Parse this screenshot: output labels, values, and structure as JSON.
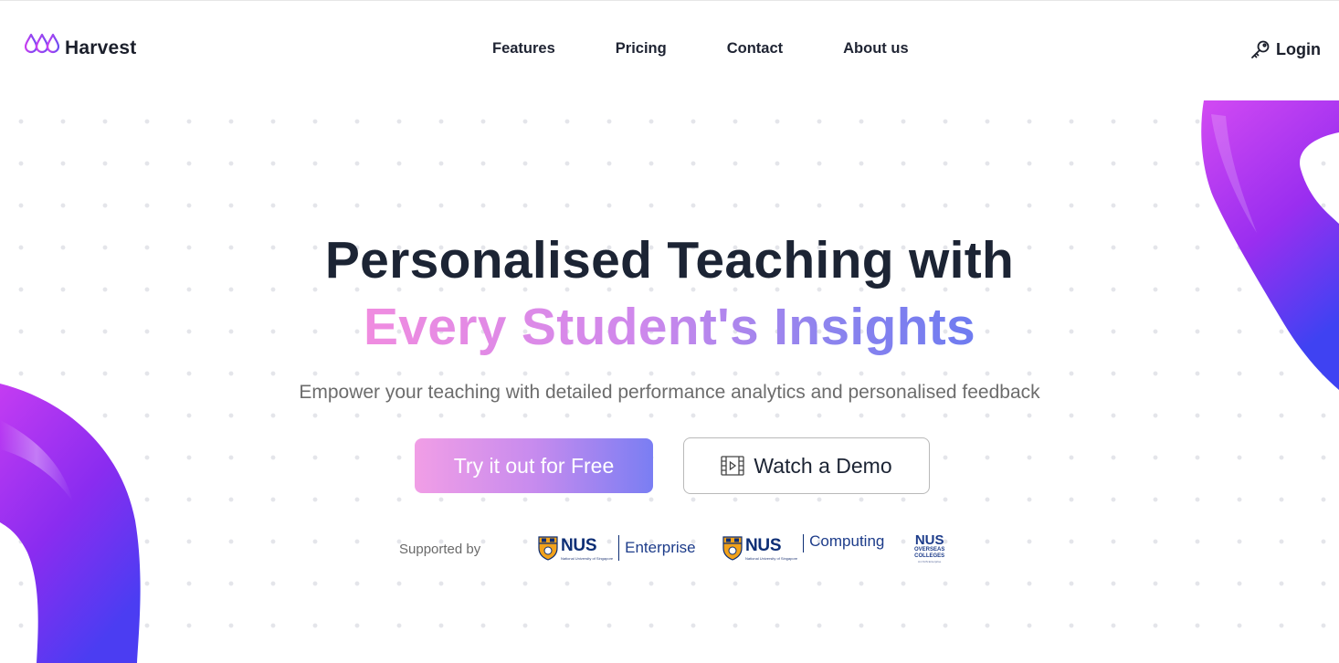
{
  "brand": {
    "name": "Harvest",
    "accent": "#a23cf0"
  },
  "nav": {
    "links": [
      "Features",
      "Pricing",
      "Contact",
      "About us"
    ],
    "login_label": "Login"
  },
  "hero": {
    "title_line1": "Personalised Teaching with",
    "title_line2": "Every Student's Insights",
    "subtitle": "Empower your teaching with detailed performance analytics and personalised feedback",
    "primary_cta": "Try it out for Free",
    "secondary_cta": "Watch a Demo"
  },
  "supporters": {
    "label": "Supported by",
    "items": [
      {
        "org": "NUS",
        "org_sub": "National University of Singapore",
        "unit": "Enterprise"
      },
      {
        "org": "NUS",
        "org_sub": "National University of Singapore",
        "unit": "Computing"
      },
      {
        "org": "NUS",
        "line2": "OVERSEAS",
        "line3": "COLLEGES",
        "tagline": "An NUS Enterprise"
      }
    ]
  },
  "icons": {
    "logo": "harvest-drops-icon",
    "login": "key-icon",
    "demo": "video-play-icon"
  }
}
